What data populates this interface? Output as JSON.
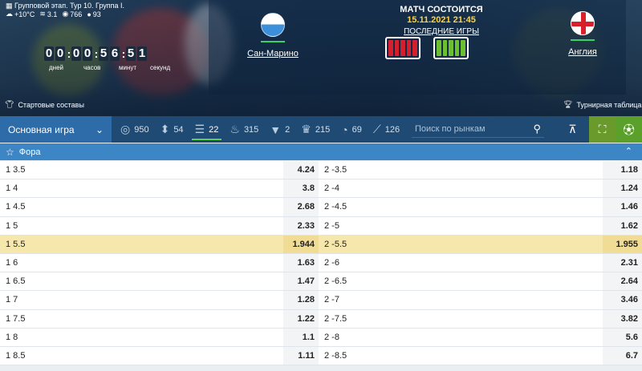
{
  "header": {
    "stage": "Групповой этап. Тур 10. Группа I.",
    "weather": {
      "temperature": "+10°C",
      "wind": "3.1",
      "pressure": "766",
      "humidity": "93"
    },
    "timer": {
      "digits": [
        "0",
        "0",
        "0",
        "0",
        "5",
        "6",
        "5",
        "1"
      ],
      "labels": [
        "дней",
        "часов",
        "минут",
        "секунд"
      ]
    },
    "home_team": "Сан-Марино",
    "away_team": "Англия",
    "match_status": "МАТЧ СОСТОИТСЯ",
    "match_datetime": "15.11.2021 21:45",
    "last_games_label": "ПОСЛЕДНИЕ ИГРЫ",
    "home_form": "red",
    "away_form": "green",
    "lineups_label": "Стартовые составы",
    "standings_label": "Турнирная таблица"
  },
  "toolbar": {
    "market_select": "Основная игра",
    "counters": [
      {
        "icon": "target-icon",
        "value": "950"
      },
      {
        "icon": "updown-arrows-icon",
        "value": "54"
      },
      {
        "icon": "bars-icon",
        "value": "22"
      },
      {
        "icon": "fire-icon",
        "value": "315"
      },
      {
        "icon": "shirt-icon",
        "value": "2"
      },
      {
        "icon": "trophy-icon",
        "value": "215"
      },
      {
        "icon": "timer-icon",
        "value": "69"
      },
      {
        "icon": "wand-icon",
        "value": "126"
      }
    ],
    "search_placeholder": "Поиск по рынкам"
  },
  "section": {
    "title": "Фора"
  },
  "table": {
    "rows": [
      {
        "left_label": "1 3.5",
        "left_odds": "4.24",
        "right_label": "2 -3.5",
        "right_odds": "1.18"
      },
      {
        "left_label": "1 4",
        "left_odds": "3.8",
        "right_label": "2 -4",
        "right_odds": "1.24"
      },
      {
        "left_label": "1 4.5",
        "left_odds": "2.68",
        "right_label": "2 -4.5",
        "right_odds": "1.46"
      },
      {
        "left_label": "1 5",
        "left_odds": "2.33",
        "right_label": "2 -5",
        "right_odds": "1.62"
      },
      {
        "left_label": "1 5.5",
        "left_odds": "1.944",
        "right_label": "2 -5.5",
        "right_odds": "1.955",
        "highlight": true
      },
      {
        "left_label": "1 6",
        "left_odds": "1.63",
        "right_label": "2 -6",
        "right_odds": "2.31"
      },
      {
        "left_label": "1 6.5",
        "left_odds": "1.47",
        "right_label": "2 -6.5",
        "right_odds": "2.64"
      },
      {
        "left_label": "1 7",
        "left_odds": "1.28",
        "right_label": "2 -7",
        "right_odds": "3.46"
      },
      {
        "left_label": "1 7.5",
        "left_odds": "1.22",
        "right_label": "2 -7.5",
        "right_odds": "3.82"
      },
      {
        "left_label": "1 8",
        "left_odds": "1.1",
        "right_label": "2 -8",
        "right_odds": "5.6"
      },
      {
        "left_label": "1 8.5",
        "left_odds": "1.11",
        "right_label": "2 -8.5",
        "right_odds": "6.7"
      }
    ]
  }
}
